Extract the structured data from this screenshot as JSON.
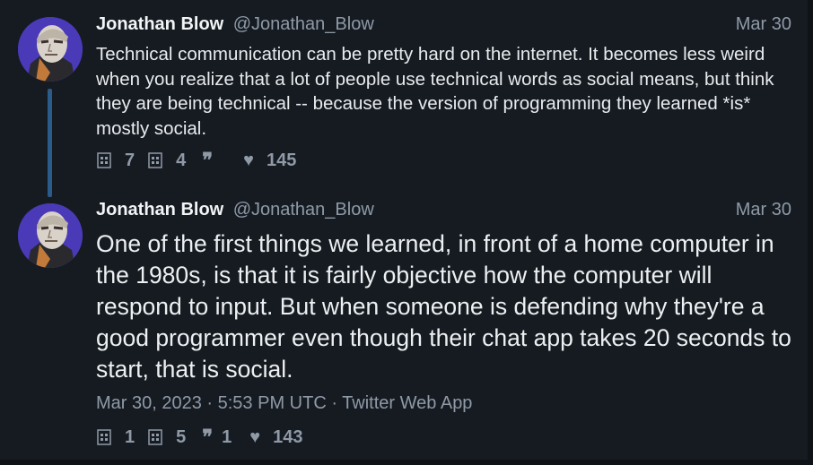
{
  "colors": {
    "background": "#161b22",
    "text": "#e8ebee",
    "muted": "#8f9aa6",
    "thread_line": "#2b5b8a",
    "avatar_bg": "#4a3ab8"
  },
  "tweets": [
    {
      "author_name": "Jonathan Blow",
      "author_handle": "@Jonathan_Blow",
      "date": "Mar 30",
      "text": "Technical communication can be pretty hard on the internet. It becomes less weird when you realize that a lot of people use technical words as social means, but think they are being technical -- because the version of programming they learned *is* mostly social.",
      "stats": {
        "replies": "7",
        "retweets": "4",
        "quotes": "",
        "likes": "145"
      }
    },
    {
      "author_name": "Jonathan Blow",
      "author_handle": "@Jonathan_Blow",
      "date": "Mar 30",
      "text": "One of the first things we learned, in front of a home computer in the 1980s, is that it is fairly objective how the computer will respond to input. But when someone is defending why they're a good programmer even though their chat app takes 20 seconds to start, that is social.",
      "meta": "Mar 30, 2023 · 5:53 PM UTC · Twitter Web App",
      "stats": {
        "replies": "1",
        "retweets": "5",
        "quotes": "1",
        "likes": "143"
      }
    }
  ],
  "icons": {
    "reply": "comment-icon",
    "retweet": "retweet-icon",
    "quote": "quote-icon",
    "like": "heart-icon"
  }
}
